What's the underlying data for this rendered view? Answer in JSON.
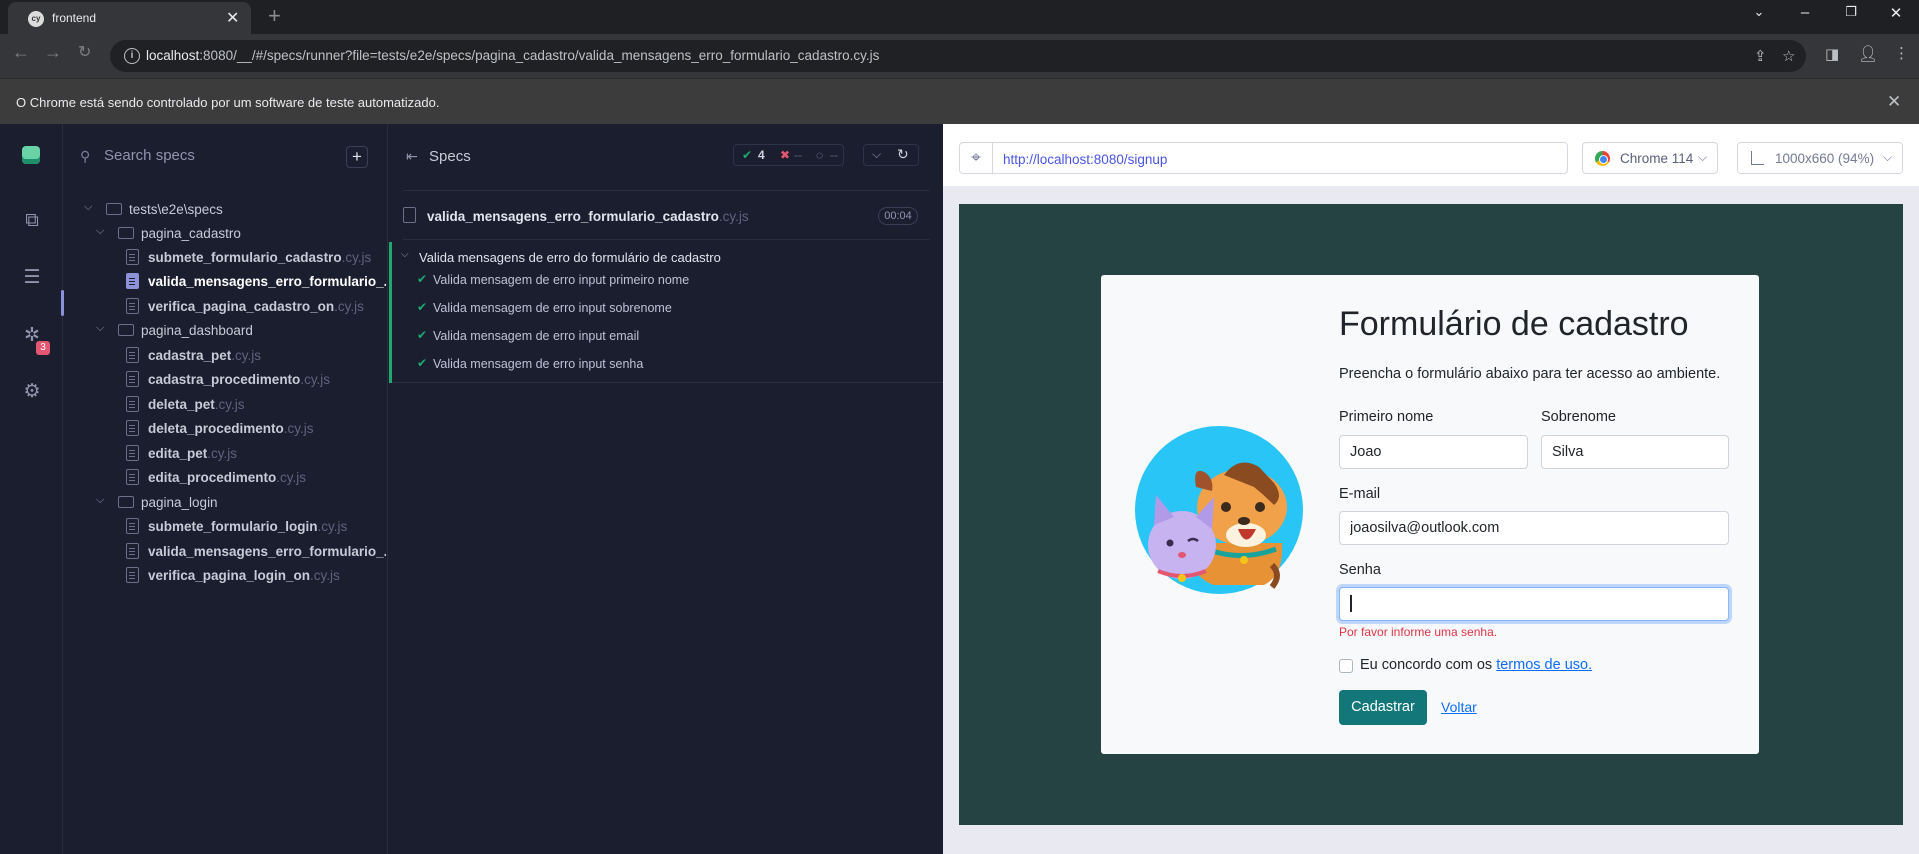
{
  "browser": {
    "tab_title": "frontend",
    "tab_favicon": "cy",
    "address_host": "localhost",
    "address_rest": ":8080/__/#/specs/runner?file=tests/e2e/specs/pagina_cadastro/valida_mensagens_erro_formulario_cadastro.cy.js",
    "automation_notice": "O Chrome está sendo controlado por um software de teste automatizado."
  },
  "nav": {
    "debug_badge": "3"
  },
  "specs_panel": {
    "search_placeholder": "Search specs",
    "root_folder": "tests\\e2e\\specs",
    "ext": ".cy.js",
    "folders": [
      {
        "name": "pagina_cadastro"
      },
      {
        "name": "pagina_dashboard"
      },
      {
        "name": "pagina_login"
      }
    ],
    "files": {
      "f1": "submete_formulario_cadastro",
      "f2": "valida_mensagens_erro_formulario_...",
      "f3": "verifica_pagina_cadastro_on",
      "f4": "cadastra_pet",
      "f5": "cadastra_procedimento",
      "f6": "deleta_pet",
      "f7": "deleta_procedimento",
      "f8": "edita_pet",
      "f9": "edita_procedimento",
      "f10": "submete_formulario_login",
      "f11": "valida_mensagens_erro_formulario_...",
      "f12": "verifica_pagina_login_on"
    }
  },
  "reporter": {
    "title": "Specs",
    "passed": "4",
    "failed": "--",
    "pending": "--",
    "spec_name": "valida_mensagens_erro_formulario_cadastro",
    "spec_ext": ".cy.js",
    "duration": "00:04",
    "suite_title": "Valida mensagens de erro do formulário de cadastro",
    "tests": [
      "Valida mensagem de erro input primeiro nome",
      "Valida mensagem de erro input sobrenome",
      "Valida mensagem de erro input email",
      "Valida mensagem de erro input senha"
    ]
  },
  "aut": {
    "url": "http://localhost:8080/signup",
    "browser_label": "Chrome 114",
    "viewport_label": "1000x660 (94%)"
  },
  "form": {
    "title": "Formulário de cadastro",
    "subtitle": "Preencha o formulário abaixo para ter acesso ao ambiente.",
    "first_name_label": "Primeiro nome",
    "first_name_value": "Joao",
    "last_name_label": "Sobrenome",
    "last_name_value": "Silva",
    "email_label": "E-mail",
    "email_value": "joaosilva@outlook.com",
    "password_label": "Senha",
    "password_value": "",
    "password_error": "Por favor informe uma senha.",
    "terms_prefix": "Eu concordo com os",
    "terms_link": "termos de uso.",
    "terms_checked": false,
    "submit_label": "Cadastrar",
    "back_label": "Voltar",
    "accent_color": "#13777a",
    "error_color": "#dc3545"
  },
  "colors": {
    "cypress_bg": "#1b1e2e",
    "pass_green": "#1fa971",
    "fail_red": "#e45770",
    "app_bg": "#254343"
  }
}
